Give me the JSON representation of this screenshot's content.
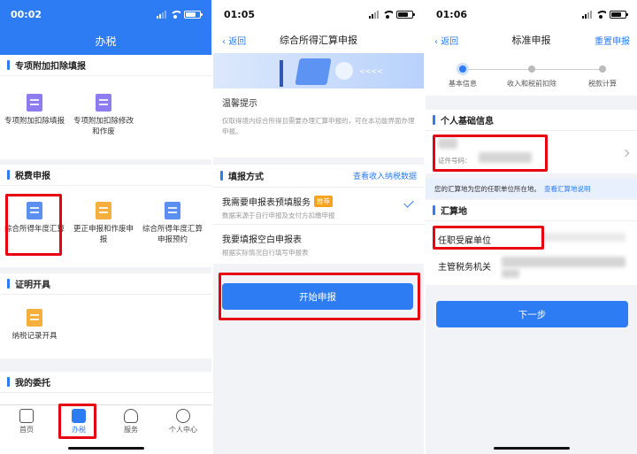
{
  "panel1": {
    "status_time": "00:02",
    "title": "办税",
    "sections": [
      {
        "title": "专项附加扣除填报",
        "items": [
          "专项附加扣除填报",
          "专项附加扣除修改和作废"
        ]
      },
      {
        "title": "税费申报",
        "items": [
          "综合所得年度汇算",
          "更正申报和作废申报",
          "综合所得年度汇算申报预约"
        ]
      },
      {
        "title": "证明开具",
        "items": [
          "纳税记录开具"
        ]
      },
      {
        "title": "我的委托",
        "items": []
      }
    ],
    "tabs": [
      "首页",
      "办税",
      "服务",
      "个人中心"
    ]
  },
  "panel2": {
    "status_time": "01:05",
    "back": "返回",
    "title": "综合所得汇算申报",
    "banner_text": "<<<<",
    "tips_title": "温馨提示",
    "tips_body": "仅取得境内综合所得且需要办理汇算申报的，可在本功能界面办理申报。",
    "fill_title": "填报方式",
    "fill_link": "查看收入纳税数据",
    "options": [
      {
        "title": "我需要申报表预填服务",
        "badge": "推荐",
        "desc": "数据来源于自行申报及支付方扣缴申报"
      },
      {
        "title": "我要填报空白申报表",
        "desc": "根据实际情况自行填写申报表"
      }
    ],
    "start_button": "开始申报"
  },
  "panel3": {
    "status_time": "01:06",
    "back": "返回",
    "title": "标准申报",
    "reset": "重置申报",
    "steps": [
      "基本信息",
      "收入和税前扣除",
      "税款计算"
    ],
    "info_title": "个人基础信息",
    "id_label": "证件号码：",
    "notice_text": "您的汇算地为您的任职单位所在地。",
    "notice_link": "查看汇算地说明",
    "place_title": "汇算地",
    "place_rows": [
      "任职受雇单位",
      "主管税务机关"
    ],
    "next_button": "下一步"
  },
  "colors": {
    "primary": "#2d7cf3",
    "highlight": "#e60012",
    "badge": "#f7a21d"
  }
}
